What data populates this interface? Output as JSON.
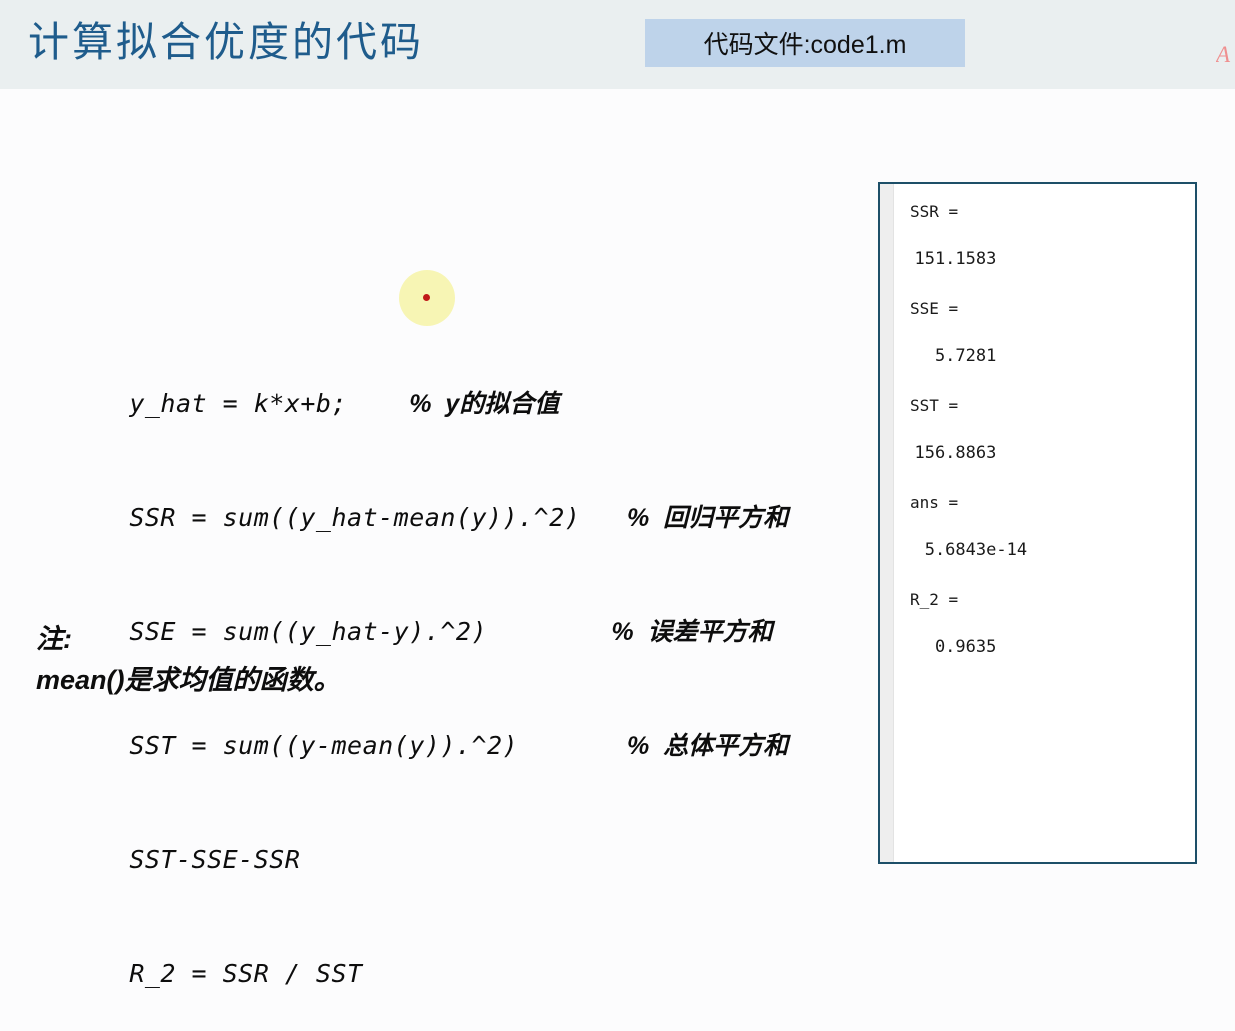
{
  "header": {
    "title": "计算拟合优度的代码",
    "badge_label": "代码文件:code1.m",
    "watermark": "A",
    "title_color": "#1f5c8c",
    "badge_bg": "#bed3ea",
    "band_bg": "#eaeff0"
  },
  "cursor": {
    "highlight_color": "#f7f5b4",
    "dot_color": "#c01919"
  },
  "code": {
    "lines": [
      {
        "code": "y_hat = k*x+b;",
        "gap": "    ",
        "comment": "%  y的拟合值"
      },
      {
        "code": "SSR = sum((y_hat-mean(y)).^2)",
        "gap": "   ",
        "comment": "%  回归平方和"
      },
      {
        "code": "SSE = sum((y_hat-y).^2)",
        "gap": "        ",
        "comment": "%  误差平方和"
      },
      {
        "code": "SST = sum((y-mean(y)).^2)",
        "gap": "       ",
        "comment": "%  总体平方和"
      },
      {
        "code": "SST-SSE-SSR",
        "gap": "",
        "comment": ""
      },
      {
        "code": "R_2 = SSR / SST",
        "gap": "",
        "comment": ""
      }
    ]
  },
  "note": {
    "label": "注:",
    "text": "mean()是求均值的函数。"
  },
  "output": {
    "entries": [
      {
        "name": "SSR =",
        "value": "  151.1583"
      },
      {
        "name": "SSE =",
        "value": "    5.7281"
      },
      {
        "name": "SST =",
        "value": "  156.8863"
      },
      {
        "name": "ans =",
        "value": "   5.6843e-14"
      },
      {
        "name": "R_2 =",
        "value": "    0.9635"
      }
    ],
    "border_color": "#1d4f68"
  }
}
